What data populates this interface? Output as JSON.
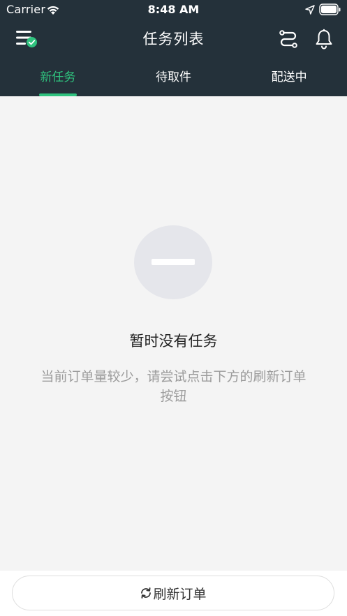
{
  "status_bar": {
    "carrier": "Carrier",
    "time": "8:48 AM"
  },
  "nav": {
    "title": "任务列表",
    "icons": {
      "menu": "menu-icon",
      "check_badge": "check-badge-icon",
      "route": "route-icon",
      "bell": "bell-icon"
    }
  },
  "tabs": [
    {
      "label": "新任务",
      "active": true
    },
    {
      "label": "待取件",
      "active": false
    },
    {
      "label": "配送中",
      "active": false
    }
  ],
  "empty_state": {
    "title": "暂时没有任务",
    "description": "当前订单量较少，请尝试点击下方的刷新订单按钮"
  },
  "bottom": {
    "refresh_label": "刷新订单"
  },
  "colors": {
    "header_bg": "#24313a",
    "accent": "#2fc27e",
    "page_bg": "#f4f4f4"
  }
}
